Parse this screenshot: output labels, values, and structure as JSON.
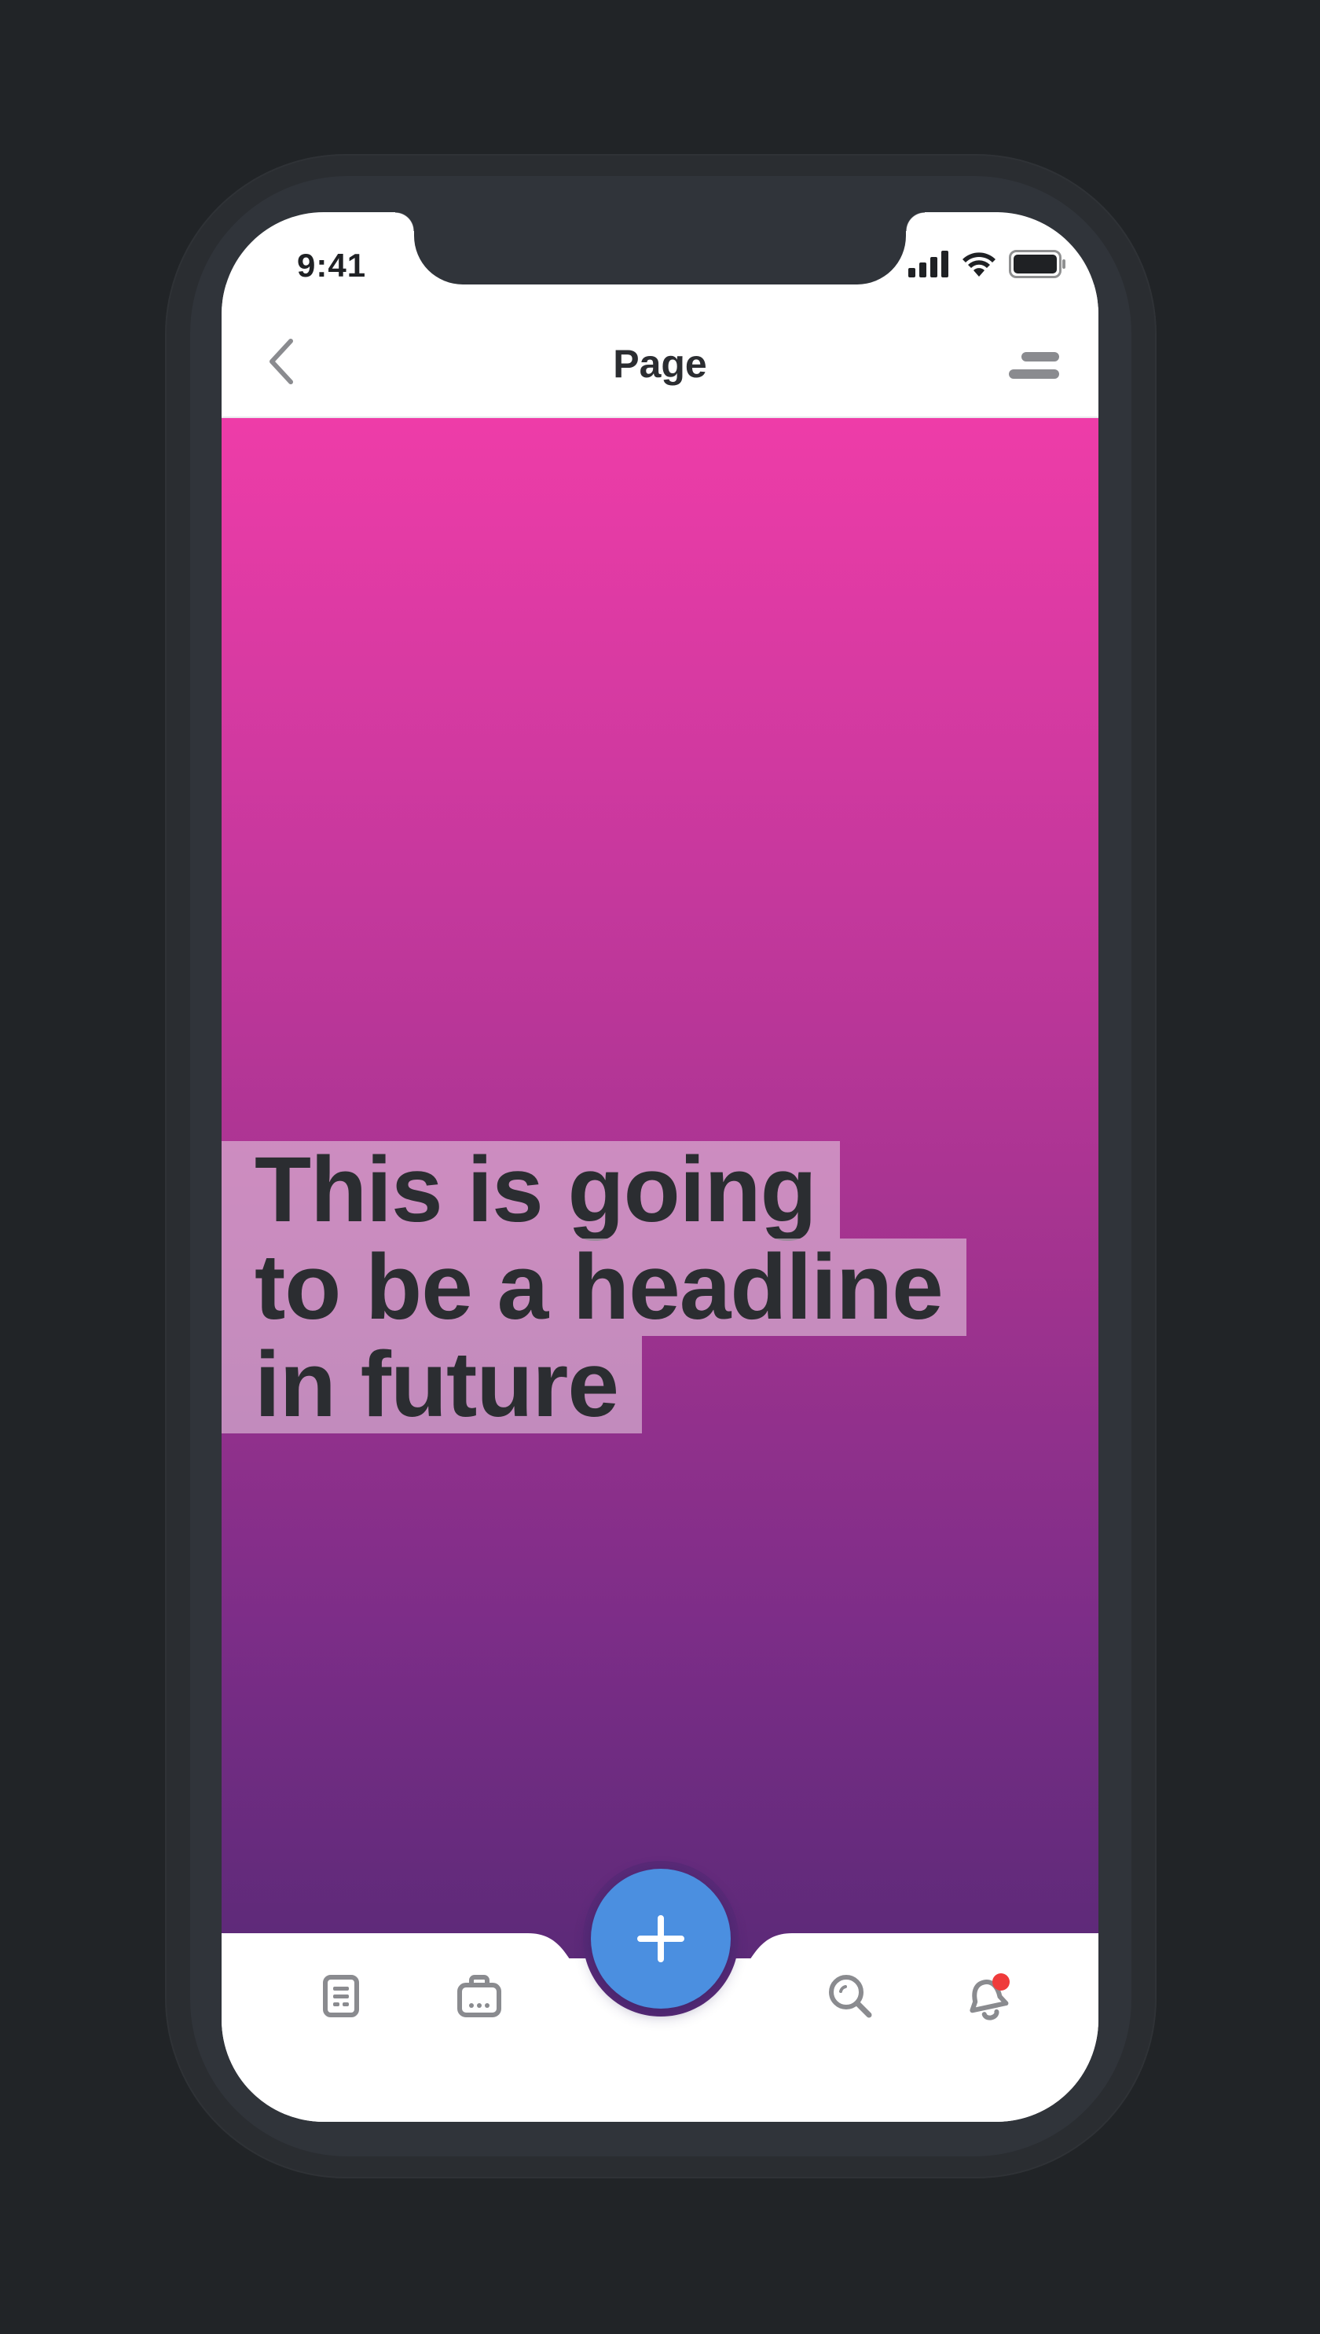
{
  "status_bar": {
    "time": "9:41"
  },
  "nav": {
    "title": "Page",
    "back_icon": "chevron-left-icon",
    "menu_icon": "menu-icon"
  },
  "hero": {
    "headline_lines": [
      "This is going",
      "to be a headline",
      "in future"
    ],
    "gradient_top": "#ee3ca8",
    "gradient_bottom": "#5c2a78"
  },
  "tabbar": {
    "items": [
      {
        "icon": "document-icon"
      },
      {
        "icon": "briefcase-icon"
      },
      {
        "icon": "search-icon"
      },
      {
        "icon": "notification-bell-icon",
        "badge": true
      }
    ],
    "fab_icon": "plus-icon",
    "fab_color": "#4b8fe0",
    "badge_color": "#ef3b3b"
  }
}
